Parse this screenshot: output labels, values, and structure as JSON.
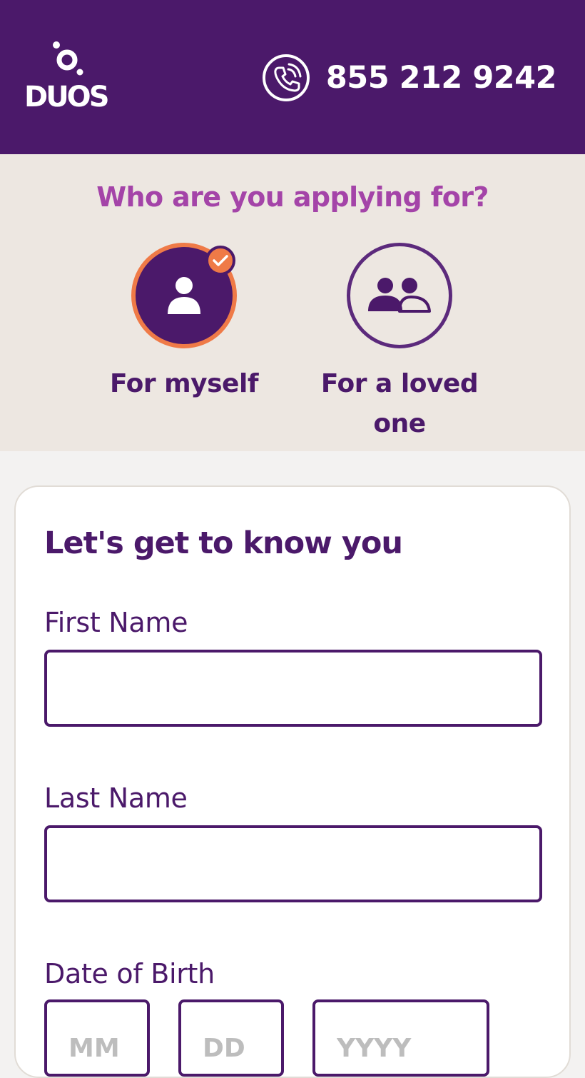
{
  "header": {
    "logo_text": "DUOS",
    "phone_number": "855 212 9242"
  },
  "applicant": {
    "title": "Who are you applying for?",
    "options": [
      {
        "label": "For myself",
        "selected": true
      },
      {
        "label": "For a loved one",
        "selected": false
      }
    ]
  },
  "form": {
    "title": "Let's get to know you",
    "first_name": {
      "label": "First Name",
      "value": ""
    },
    "last_name": {
      "label": "Last Name",
      "value": ""
    },
    "dob": {
      "label": "Date of Birth",
      "month_placeholder": "MM",
      "day_placeholder": "DD",
      "year_placeholder": "YYYY"
    }
  },
  "colors": {
    "brand_purple": "#4b196a",
    "title_magenta": "#a444a8",
    "accent_orange": "#ef7a47",
    "section_beige": "#ede7e1"
  }
}
